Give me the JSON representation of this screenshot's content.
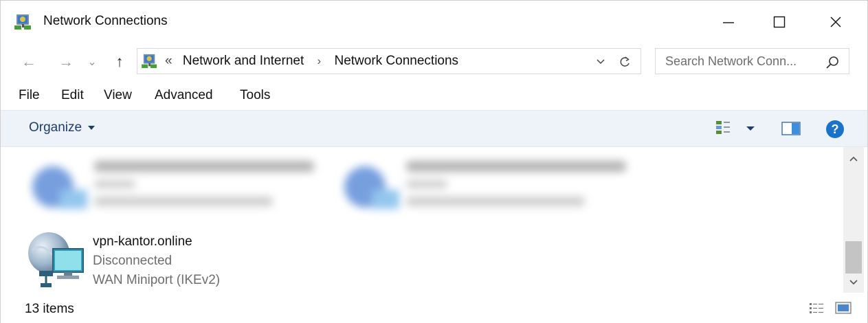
{
  "window": {
    "title": "Network Connections",
    "controls": {
      "minimize": "minimize-icon",
      "maximize": "maximize-icon",
      "close": "close-icon"
    }
  },
  "nav": {
    "back": "←",
    "forward": "→",
    "recent": "⌄",
    "up": "↑"
  },
  "address": {
    "overflow": "«",
    "crumbs": [
      "Network and Internet",
      "Network Connections"
    ],
    "separator": "›"
  },
  "search": {
    "placeholder": "Search Network Conn..."
  },
  "menu": [
    "File",
    "Edit",
    "View",
    "Advanced",
    "Tools"
  ],
  "commandbar": {
    "organize_label": "Organize"
  },
  "items": [
    {
      "name": "vpn-kantor.online",
      "status": "Disconnected",
      "device": "WAN Miniport (IKEv2)"
    }
  ],
  "status": {
    "count": "13 items"
  },
  "colors": {
    "accent": "#1a73c9",
    "commandbar_bg": "#eef3f9",
    "secondary_text": "#6d6d6d"
  }
}
